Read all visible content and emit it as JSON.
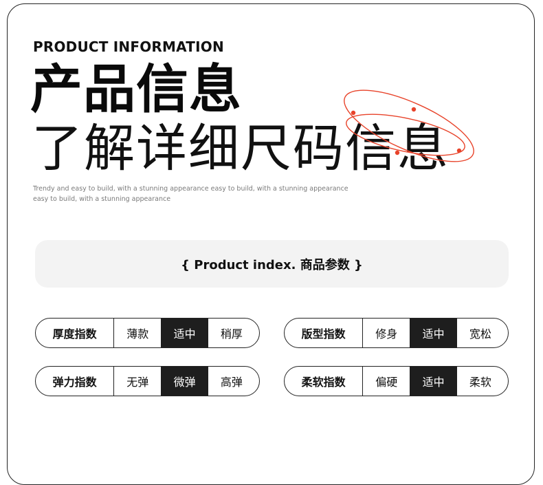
{
  "header": {
    "en_title": "PRODUCT INFORMATION",
    "cn_title": "产品信息",
    "cn_subtitle": "了解详细尺码信息",
    "description": "Trendy and easy to build, with a stunning appearance easy to build, with a stunning appearance easy to build, with a stunning appearance"
  },
  "index_bar": {
    "text": "{ Product index. 商品参数 }"
  },
  "accent_color": "#e8432a",
  "indices": [
    {
      "label": "厚度指数",
      "options": [
        "薄款",
        "适中",
        "稍厚"
      ],
      "selected": 1
    },
    {
      "label": "版型指数",
      "options": [
        "修身",
        "适中",
        "宽松"
      ],
      "selected": 1
    },
    {
      "label": "弹力指数",
      "options": [
        "无弹",
        "微弹",
        "高弹"
      ],
      "selected": 1
    },
    {
      "label": "柔软指数",
      "options": [
        "偏硬",
        "适中",
        "柔软"
      ],
      "selected": 1
    }
  ]
}
